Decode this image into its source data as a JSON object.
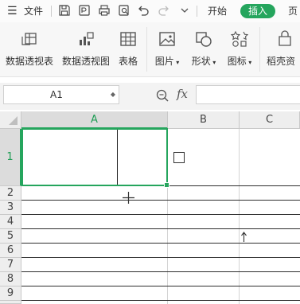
{
  "menubar": {
    "file_label": "文件",
    "tabs": [
      {
        "label": "开始"
      },
      {
        "label": "插入",
        "active": true
      },
      {
        "label": "页"
      }
    ],
    "accent_color": "#25a55d"
  },
  "ribbon": {
    "items": [
      {
        "label": "数据透视表",
        "icon": "pivot-table-icon"
      },
      {
        "label": "数据透视图",
        "icon": "pivot-chart-icon"
      },
      {
        "label": "表格",
        "icon": "table-icon"
      },
      {
        "label": "图片",
        "icon": "picture-icon",
        "dropdown": true
      },
      {
        "label": "形状",
        "icon": "shape-icon",
        "dropdown": true
      },
      {
        "label": "图标",
        "icon": "icon-library-icon",
        "dropdown": true
      },
      {
        "label": "稻壳资",
        "icon": "docer-icon"
      }
    ]
  },
  "formula_bar": {
    "name_box": "A1",
    "fx_label": "fx",
    "formula": ""
  },
  "sheet": {
    "columns": [
      "A",
      "B",
      "C"
    ],
    "rows": [
      "1",
      "2",
      "3",
      "4",
      "5",
      "6",
      "7",
      "8",
      "9"
    ],
    "selected_cell": "A1"
  }
}
